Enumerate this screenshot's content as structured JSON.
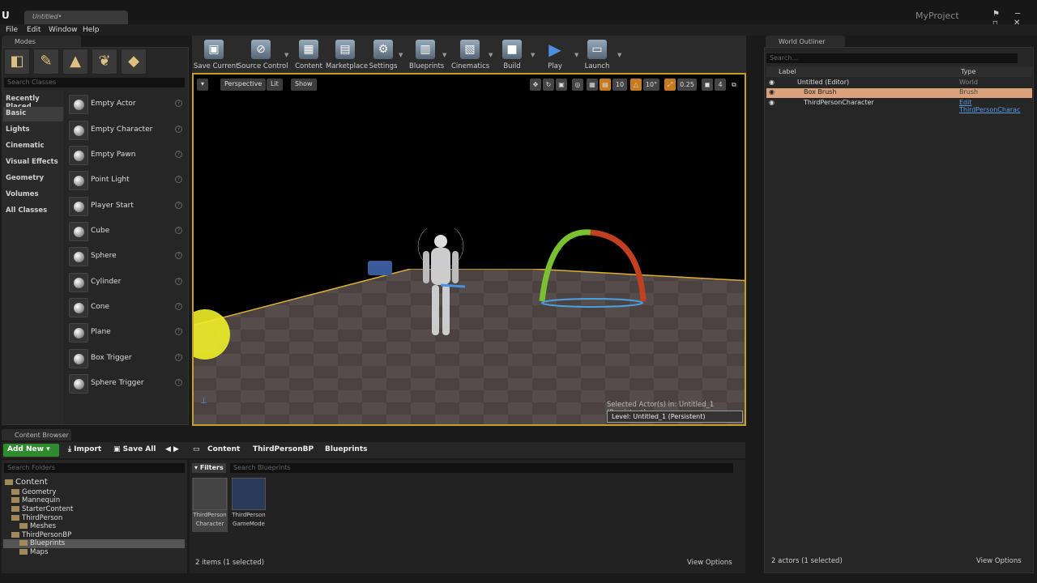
{
  "window": {
    "tab": "Untitled•",
    "project": "MyProject",
    "controls": "⚑ ─ ▫ ✕"
  },
  "menu": [
    "File",
    "Edit",
    "Window",
    "Help"
  ],
  "modes": {
    "tab": "Modes",
    "search_placeholder": "Search Classes",
    "categories": [
      "Recently Placed",
      "Basic",
      "Lights",
      "Cinematic",
      "Visual Effects",
      "Geometry",
      "Volumes",
      "All Classes"
    ],
    "selected_category": "Basic",
    "items": [
      "Empty Actor",
      "Empty Character",
      "Empty Pawn",
      "Point Light",
      "Player Start",
      "Cube",
      "Sphere",
      "Cylinder",
      "Cone",
      "Plane",
      "Box Trigger",
      "Sphere Trigger"
    ]
  },
  "toolbar": [
    "Save Current",
    "Source Control",
    "Content",
    "Marketplace",
    "Settings",
    "Blueprints",
    "Cinematics",
    "Build",
    "Play",
    "Launch"
  ],
  "viewport": {
    "perspective": "Perspective",
    "lit": "Lit",
    "show": "Show",
    "grid": "10",
    "rot": "10°",
    "scale": "0.25",
    "cam": "4",
    "selected_info": "Selected Actor(s) in:  Untitled_1 (Persistent)",
    "level": "Level:  Untitled_1 (Persistent)"
  },
  "outliner": {
    "tab": "World Outliner",
    "search_placeholder": "Search...",
    "col_label": "Label",
    "col_type": "Type",
    "rows": [
      {
        "label": "Untitled (Editor)",
        "type": "World"
      },
      {
        "label": "Box Brush",
        "type": "Brush"
      },
      {
        "label": "ThirdPersonCharacter",
        "type": "Edit ThirdPersonCharac"
      }
    ],
    "footer": "2 actors (1 selected)",
    "view_options": "View Options"
  },
  "content_browser": {
    "tab": "Content Browser",
    "add_new": "Add New",
    "import": "Import",
    "save_all": "Save All",
    "breadcrumb": [
      "Content",
      "ThirdPersonBP",
      "Blueprints"
    ],
    "search_folders": "Search Folders",
    "filters": "Filters",
    "search_bp": "Search Blueprints",
    "folders": [
      "Content",
      "Geometry",
      "Mannequin",
      "StarterContent",
      "ThirdPerson",
      "Meshes",
      "ThirdPersonBP",
      "Blueprints",
      "Maps"
    ],
    "assets": [
      {
        "l1": "ThirdPerson",
        "l2": "Character"
      },
      {
        "l1": "ThirdPerson",
        "l2": "GameMode"
      }
    ],
    "count": "2 items (1 selected)",
    "view_options": "View Options"
  }
}
